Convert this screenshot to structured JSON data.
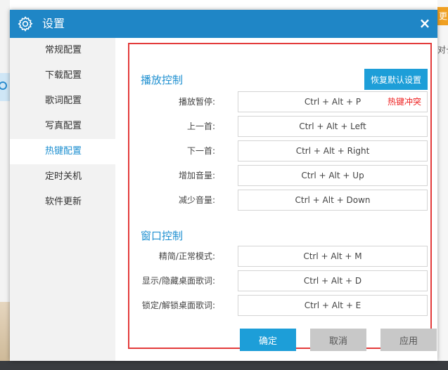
{
  "background": {
    "right_button_text": "更",
    "right_snippet_text": "对长"
  },
  "dialog": {
    "title": "设置",
    "close_glyph": "×"
  },
  "sidebar": {
    "items": [
      {
        "label": "常规配置"
      },
      {
        "label": "下载配置"
      },
      {
        "label": "歌词配置"
      },
      {
        "label": "写真配置"
      },
      {
        "label": "热键配置",
        "active": true
      },
      {
        "label": "定时关机"
      },
      {
        "label": "软件更新"
      }
    ]
  },
  "playback": {
    "title": "播放控制",
    "restore_label": "恢复默认设置",
    "rows": [
      {
        "label": "播放暂停:",
        "value": "Ctrl + Alt + P",
        "note": "热键冲突"
      },
      {
        "label": "上一首:",
        "value": "Ctrl + Alt + Left"
      },
      {
        "label": "下一首:",
        "value": "Ctrl + Alt + Right"
      },
      {
        "label": "增加音量:",
        "value": "Ctrl + Alt + Up"
      },
      {
        "label": "减少音量:",
        "value": "Ctrl + Alt + Down"
      }
    ]
  },
  "window_ctrl": {
    "title": "窗口控制",
    "rows": [
      {
        "label": "精简/正常模式:",
        "value": "Ctrl + Alt + M"
      },
      {
        "label": "显示/隐藏桌面歌词:",
        "value": "Ctrl + Alt + D"
      },
      {
        "label": "锁定/解锁桌面歌词:",
        "value": "Ctrl + Alt + E"
      }
    ]
  },
  "footer": {
    "ok_label": "确定",
    "cancel_label": "取消",
    "apply_label": "应用"
  },
  "colors": {
    "titlebar": "#1f86c6",
    "accent": "#1d8fd0",
    "button_primary": "#1d9ed8",
    "conflict_text": "#e22222",
    "highlight_border": "#e33b3b"
  }
}
